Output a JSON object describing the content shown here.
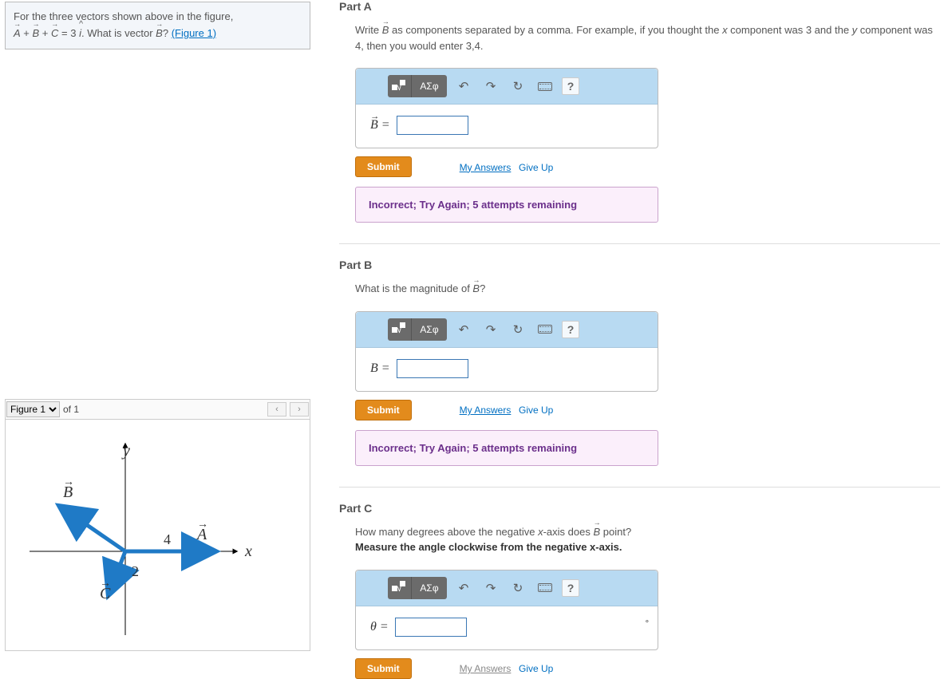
{
  "problem": {
    "text_prefix": "For the three vectors shown above in the figure,",
    "equation_lhs_A": "A",
    "equation_lhs_B": "B",
    "equation_lhs_C": "C",
    "equation_rhs_num": "3",
    "equation_rhs_unit": "i",
    "question_text": ". What is vector",
    "question_vec": "B",
    "question_tail": "? ",
    "figure_link": "(Figure 1)"
  },
  "figure": {
    "selected": "Figure 1",
    "of_text": "of 1"
  },
  "fig_labels": {
    "y": "y",
    "x": "x",
    "A": "A",
    "B": "B",
    "C": "C",
    "num4": "4",
    "num2": "2"
  },
  "toolbar": {
    "greek": "ΑΣφ",
    "help": "?"
  },
  "icons": {
    "template": "template",
    "undo": "↶",
    "redo": "↷",
    "reset": "↻",
    "keyboard": "keyboard"
  },
  "common": {
    "submit": "Submit",
    "my_answers": "My Answers",
    "give_up": "Give Up"
  },
  "partA": {
    "heading": "Part A",
    "desc_pre": "Write ",
    "desc_vec": "B",
    "desc_mid": " as components separated by a comma. For example, if you thought the ",
    "x": "x",
    "desc_mid2": " component was 3 and the ",
    "y": "y",
    "desc_end": " component was 4, then you would enter 3,4.",
    "label_sym": "B",
    "label_eq": " =",
    "feedback": "Incorrect; Try Again; 5 attempts remaining"
  },
  "partB": {
    "heading": "Part B",
    "desc_pre": "What is the magnitude of ",
    "desc_vec": "B",
    "desc_end": "?",
    "label_sym": "B",
    "label_eq": " =",
    "feedback": "Incorrect; Try Again; 5 attempts remaining"
  },
  "partC": {
    "heading": "Part C",
    "desc_pre": "How many degrees above the negative ",
    "x": "x",
    "desc_mid": "-axis does ",
    "desc_vec": "B",
    "desc_end": " point?",
    "bold_desc": "Measure the angle clockwise from the negative x-axis.",
    "label_sym": "θ",
    "label_eq": " =",
    "unit": "∘"
  }
}
